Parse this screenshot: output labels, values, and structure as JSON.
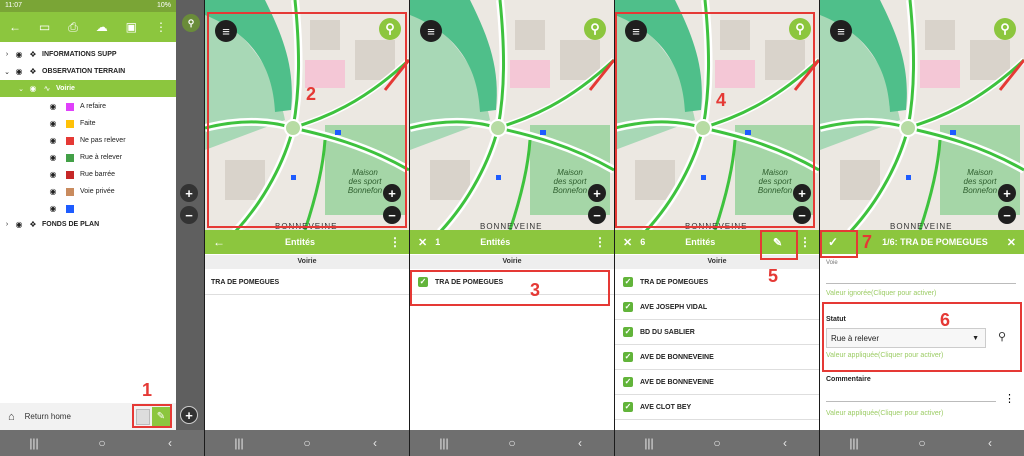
{
  "status": {
    "time": "11:07",
    "battery": "10%"
  },
  "layers": {
    "groups": [
      {
        "label": "INFORMATIONS SUPP"
      },
      {
        "label": "OBSERVATION TERRAIN"
      }
    ],
    "selected": {
      "label": "Voirie"
    },
    "legend": [
      {
        "label": "A refaire",
        "color": "#e040fb"
      },
      {
        "label": "Faite",
        "color": "#ffc107"
      },
      {
        "label": "Ne pas relever",
        "color": "#e53935"
      },
      {
        "label": "Rue à relever",
        "color": "#43a047"
      },
      {
        "label": "Rue barrée",
        "color": "#c62828"
      },
      {
        "label": "Voie privée",
        "color": "#c98b5e"
      },
      {
        "label": "",
        "color": "#1e5cff"
      }
    ],
    "bottom_group": {
      "label": "FONDS DE PLAN"
    },
    "return_home": "Return home"
  },
  "map": {
    "label_text": "Maison\ndes sport\nBonnefon",
    "street": "BONNEVEINE",
    "zoom_in": "+",
    "zoom_out": "−"
  },
  "annotations": [
    "1",
    "2",
    "3",
    "4",
    "5",
    "6",
    "7"
  ],
  "panel2": {
    "title": "Entités",
    "column": "Voirie",
    "rows": [
      "TRA DE POMEGUES"
    ]
  },
  "panel3": {
    "count": "1",
    "title": "Entités",
    "column": "Voirie",
    "rows": [
      "TRA DE POMEGUES"
    ]
  },
  "panel4": {
    "count": "6",
    "title": "Entités",
    "column": "Voirie",
    "rows": [
      "TRA DE POMEGUES",
      "AVE JOSEPH VIDAL",
      "BD DU SABLIER",
      "AVE DE BONNEVEINE",
      "AVE DE BONNEVEINE",
      "AVE CLOT BEY"
    ]
  },
  "panel5": {
    "title": "1/6: TRA DE POMEGUES",
    "field_top_label": "Voie",
    "field_top_status": "Valeur ignorée(Cliquer pour activer)",
    "statut_label": "Statut",
    "statut_value": "Rue à relever",
    "statut_status": "Valeur appliquée(Cliquer pour activer)",
    "comment_label": "Commentaire",
    "comment_status": "Valeur appliquée(Cliquer pour activer)"
  }
}
